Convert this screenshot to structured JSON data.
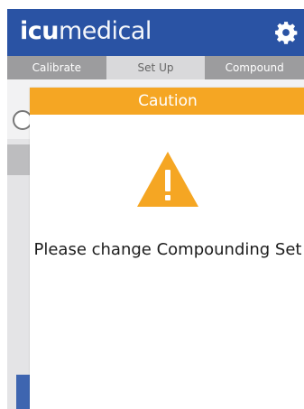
{
  "header": {
    "logo_bold": "icu",
    "logo_thin": "medical"
  },
  "tabs": [
    {
      "label": "Calibrate"
    },
    {
      "label": "Set Up"
    },
    {
      "label": "Compound"
    }
  ],
  "dialog": {
    "title": "Caution",
    "icon": "warning-triangle-icon",
    "message": "Please change Compounding Set"
  },
  "colors": {
    "header_bg": "#2a53a4",
    "caution_bar": "#f5a623",
    "left_button": "#3e65b0",
    "right_button": "#3fbf4a"
  }
}
